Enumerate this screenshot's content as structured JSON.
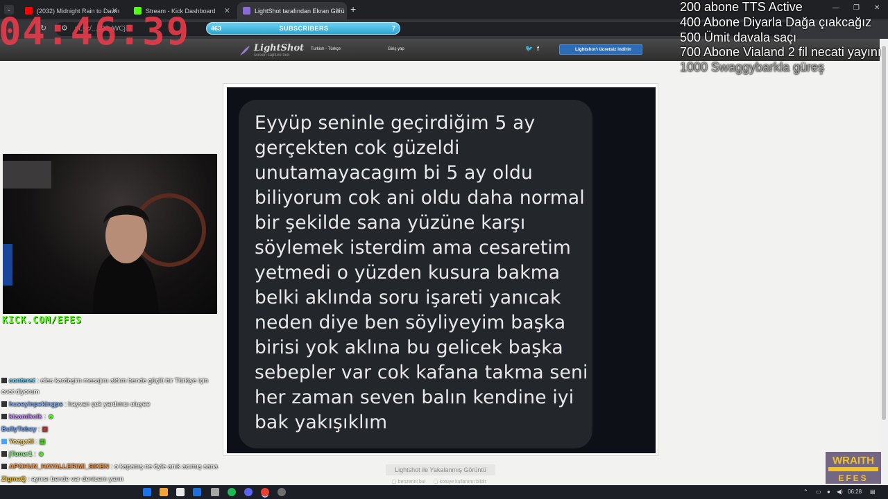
{
  "browser": {
    "tabs": [
      {
        "label": "(2032) Midnight Rain to Dawn",
        "fav_color": "#ff0000"
      },
      {
        "label": "Stream - Kick Dashboard",
        "fav_color": "#53fc18"
      },
      {
        "label": "LightShot tarafından Ekran Görü",
        "fav_color": "#8c6bd6"
      }
    ],
    "address": "nt.sc/...490vWCj"
  },
  "lightshot": {
    "logo": "LightShot",
    "tagline": "screen capture tool",
    "language": "Turkish - Türkçe",
    "login": "Giriş yap",
    "download": "Lightshot'ı ücretsiz indirin",
    "caption": "Lightshot ile Yakalanmış Görüntü",
    "link_similar": "benzerini bul",
    "link_abuse": "kötüye kullanımı bildir"
  },
  "message": {
    "lines": [
      "Eyyüp seninle geçirdiğim 5 ay",
      "gerçekten cok güzeldi",
      "unutamayacagım bi 5 ay oldu",
      "biliyorum cok ani oldu daha normal",
      "bir şekilde sana yüzüne karşı",
      "söylemek isterdim ama cesaretim",
      "yetmedi o yüzden kusura bakma",
      "belki aklında soru işareti yanıcak",
      "neden diye ben söyliyeyim başka",
      "birisi yok aklına bu gelicek başka",
      "sebepler var cok kafana takma seni",
      "her zaman seven balın kendine iyi",
      "bak yakışıklım"
    ]
  },
  "overlay": {
    "timer": "04:46:39",
    "subs_current": "463",
    "subs_label": "SUBSCRIBERS",
    "subs_right": "7",
    "goals": [
      "200 abone TTS Active",
      "400 Abone Diyarla Dağa çıakcağız",
      "500 Ümit davala saçı",
      "700 Abone Vialand 2 fil necati yayını",
      "1000 Swaggybarkla güreş"
    ],
    "kick_url": "KICK.COM/EFES",
    "wraith_line1": "WRAITH",
    "wraith_line2": "EFES"
  },
  "chat": [
    {
      "user": "conteret",
      "color": "#5fd3ff",
      "text": ": efes kardeşim mesajını aldım bende güçlü bir Türkiye için"
    },
    {
      "user": "",
      "color": "#ffffff",
      "text": "evet diyorum"
    },
    {
      "user": "huseyinpekingps",
      "color": "#88b4ff",
      "text": ": hayvan çok yardımcı oluyee"
    },
    {
      "user": "kizamikcik",
      "color": "#c68cff",
      "text": ":"
    },
    {
      "user": "BullyTobey",
      "color": "#6fa8ff",
      "text": ":"
    },
    {
      "user": "Yozgatli",
      "color": "#ffd966",
      "text": ":"
    },
    {
      "user": "jToner1",
      "color": "#8cff8c",
      "text": ":"
    },
    {
      "user": "APOHUN_HAYALLERIMI_SIKEN",
      "color": "#ff9c4a",
      "text": ": o kapanış ne öyle anık acımış sana"
    },
    {
      "user": "ZigmaQ",
      "color": "#ffcc33",
      "text": ": aynısı bende var denicem yarın"
    }
  ],
  "taskbar": {
    "time": "06:28"
  },
  "colors": {
    "timer": "#e83a49",
    "kick_green": "#53fc18",
    "bubble": "#23262b",
    "shot_bg": "#0d1117"
  }
}
